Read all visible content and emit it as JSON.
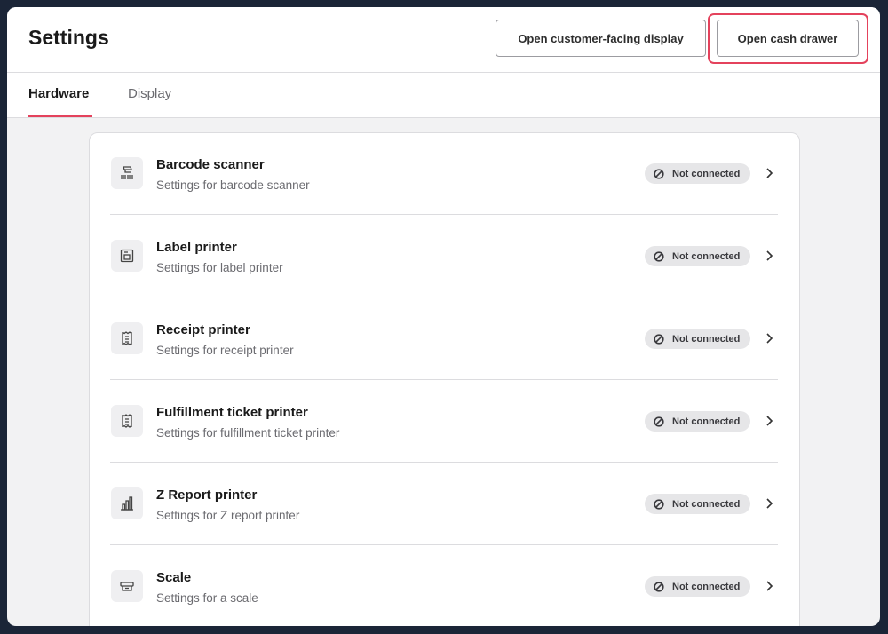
{
  "header": {
    "title": "Settings",
    "display_button": "Open customer-facing display",
    "drawer_button": "Open cash drawer"
  },
  "tabs": [
    {
      "label": "Hardware",
      "active": true
    },
    {
      "label": "Display",
      "active": false
    }
  ],
  "colors": {
    "accent": "#e4425c"
  },
  "devices": [
    {
      "icon": "barcode-scanner-icon",
      "title": "Barcode scanner",
      "subtitle": "Settings for barcode scanner",
      "status": "Not connected"
    },
    {
      "icon": "label-printer-icon",
      "title": "Label printer",
      "subtitle": "Settings for label printer",
      "status": "Not connected"
    },
    {
      "icon": "receipt-printer-icon",
      "title": "Receipt printer",
      "subtitle": "Settings for receipt printer",
      "status": "Not connected"
    },
    {
      "icon": "fulfillment-printer-icon",
      "title": "Fulfillment ticket printer",
      "subtitle": "Settings for fulfillment ticket printer",
      "status": "Not connected"
    },
    {
      "icon": "z-report-printer-icon",
      "title": "Z Report printer",
      "subtitle": "Settings for Z report printer",
      "status": "Not connected"
    },
    {
      "icon": "scale-icon",
      "title": "Scale",
      "subtitle": "Settings for a scale",
      "status": "Not connected"
    }
  ]
}
